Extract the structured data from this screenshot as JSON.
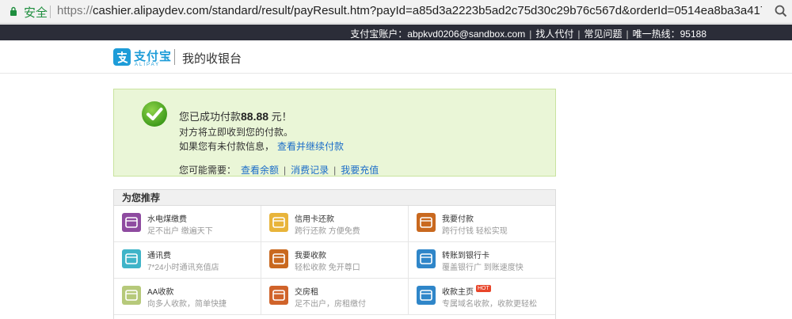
{
  "browser": {
    "secure_label": "安全",
    "url_scheme": "https://",
    "url_rest": "cashier.alipaydev.com/standard/result/payResult.htm?payId=a85d3a2223b5ad2c75d30c29b76c567d&orderId=0514ea8ba3a417..."
  },
  "topbar": {
    "account": "支付宝账户：abpkvd0206@sandbox.com",
    "find_payer": "找人代付",
    "faq": "常见问题",
    "hotline": "唯一热线：95188"
  },
  "header": {
    "logo_cn": "支付宝",
    "logo_en": "ALIPAY",
    "title": "我的收银台"
  },
  "success": {
    "prefix": "您已成功付款",
    "amount": "88.88",
    "suffix": " 元！",
    "line2": "对方将立即收到您的付款。",
    "line3": "如果您有未付款信息，",
    "line3_link": "查看并继续付款",
    "need_label": "您可能需要：",
    "need_links": [
      "查看余额",
      "消费记录",
      "我要充值"
    ]
  },
  "recommend": {
    "title": "为您推荐",
    "items": [
      {
        "title": "水电煤缴费",
        "sub": "足不出户  缴遍天下",
        "icon": "utilities-icon",
        "color": "#8e4ba0"
      },
      {
        "title": "信用卡还款",
        "sub": "跨行还款  方便免费",
        "icon": "credit-card-icon",
        "color": "#e8b43a"
      },
      {
        "title": "我要付款",
        "sub": "跨行付钱  轻松实现",
        "icon": "send-money-icon",
        "color": "#c9691f"
      },
      {
        "title": "通讯费",
        "sub": "7*24小时通讯充值店",
        "icon": "phone-recharge-icon",
        "color": "#3fb4c8"
      },
      {
        "title": "我要收款",
        "sub": "轻松收款  免开尊口",
        "icon": "receive-money-icon",
        "color": "#c9691f"
      },
      {
        "title": "转账到银行卡",
        "sub": "覆盖银行广  到账速度快",
        "icon": "bank-transfer-icon",
        "color": "#2f86c9"
      },
      {
        "title": "AA收款",
        "sub": "向多人收款，简单快捷",
        "icon": "aa-collect-icon",
        "color": "#b6c97a"
      },
      {
        "title": "交房租",
        "sub": "足不出户，房租缴付",
        "icon": "rent-icon",
        "color": "#d0632a"
      },
      {
        "title": "收款主页",
        "sub": "专属域名收款，收款更轻松",
        "icon": "homepage-icon",
        "color": "#2f86c9",
        "badge": "HOT"
      }
    ]
  }
}
